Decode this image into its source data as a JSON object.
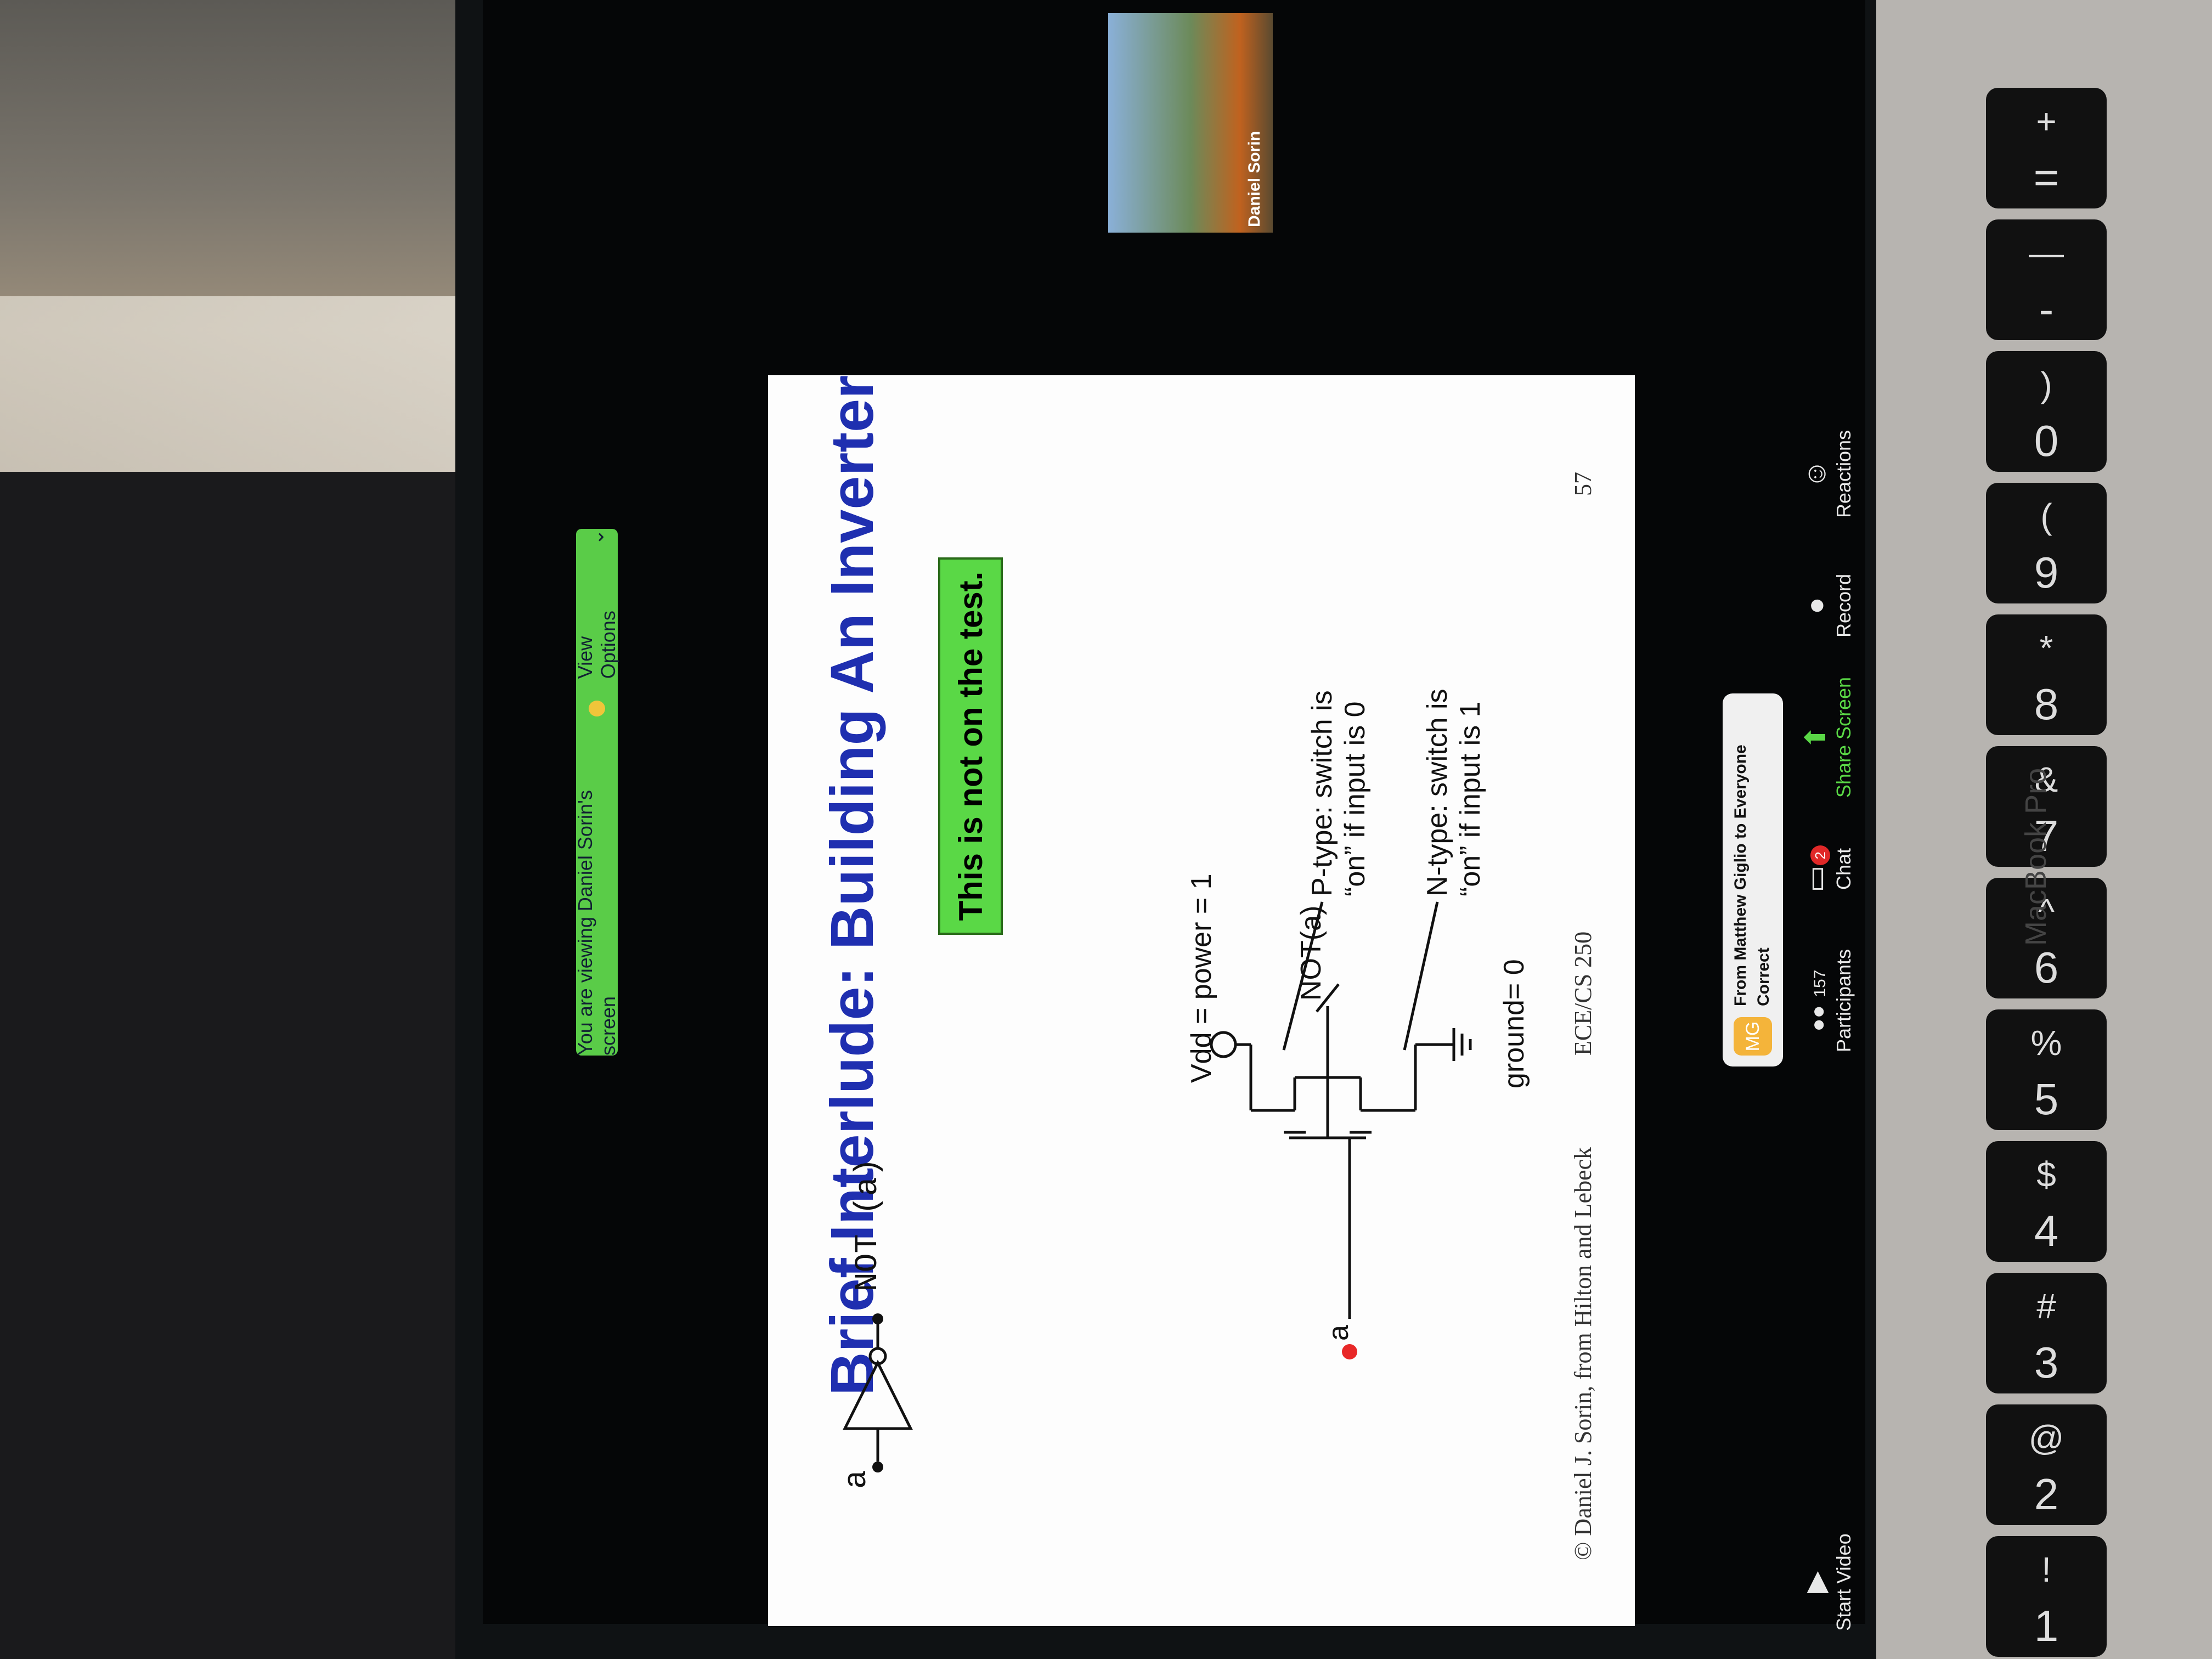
{
  "banner": {
    "text": "You are viewing Daniel Sorin's screen",
    "view_options": "View Options"
  },
  "slide": {
    "title": "Brief Interlude: Building An Inverter",
    "note": "This is not on the test.",
    "gate_input": "a",
    "gate_output": "NOT (a)",
    "vdd": "Vdd = power = 1",
    "circuit_input": "a",
    "circuit_output": "NOT(a)",
    "ground": "ground= 0",
    "ptype_line1": "P-type: switch is",
    "ptype_line2": "“on” if input is 0",
    "ntype_line1": "N-type: switch is",
    "ntype_line2": "“on” if input is 1",
    "footer_left": "© Daniel J. Sorin, from Hilton and Lebeck",
    "footer_center": "ECE/CS 250",
    "page_number": "57"
  },
  "chat_popup": {
    "avatar": "MG",
    "from": "From Matthew Giglio to Everyone",
    "message": "Correct"
  },
  "toolbar": {
    "start_video": "Start Video",
    "participants": "Participants",
    "participants_count": "157",
    "chat": "Chat",
    "chat_badge": "2",
    "share_screen": "Share Screen",
    "record": "Record",
    "reactions": "Reactions"
  },
  "video_thumb": {
    "name": "Daniel Sorin"
  },
  "laptop_label": "MacBook Pro",
  "keys": [
    {
      "top": "!",
      "bot": "1"
    },
    {
      "top": "@",
      "bot": "2"
    },
    {
      "top": "#",
      "bot": "3"
    },
    {
      "top": "$",
      "bot": "4"
    },
    {
      "top": "%",
      "bot": "5"
    },
    {
      "top": "^",
      "bot": "6"
    },
    {
      "top": "&",
      "bot": "7"
    },
    {
      "top": "*",
      "bot": "8"
    },
    {
      "top": "(",
      "bot": "9"
    },
    {
      "top": ")",
      "bot": "0"
    },
    {
      "top": "—",
      "bot": "-"
    },
    {
      "top": "+",
      "bot": "="
    }
  ]
}
